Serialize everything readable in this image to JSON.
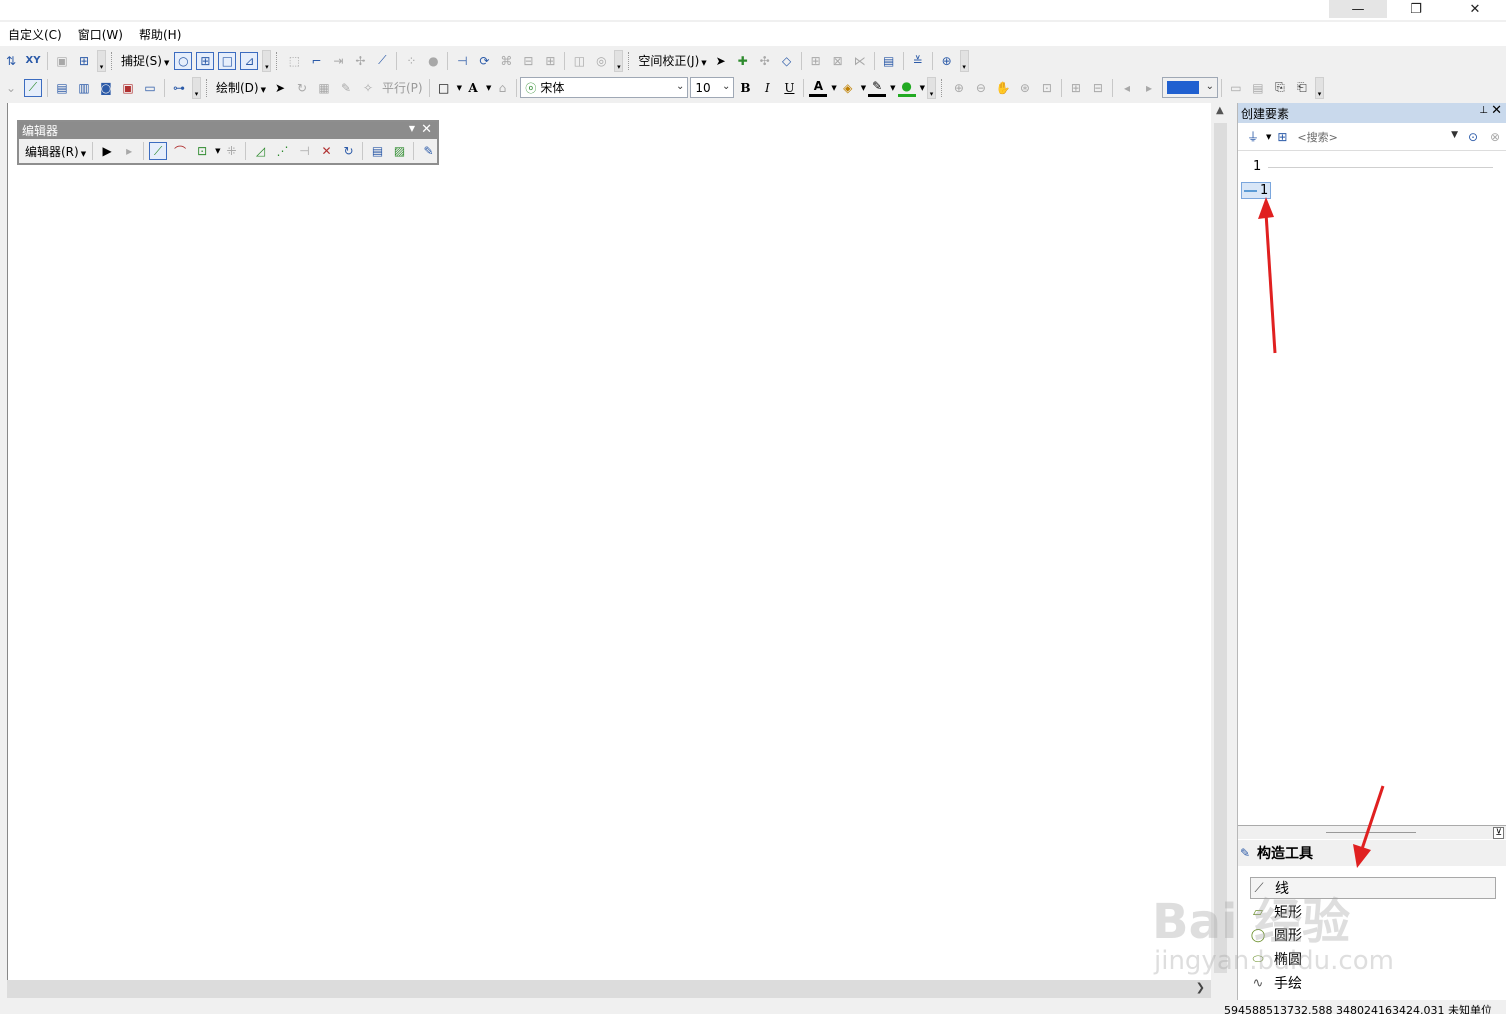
{
  "window": {
    "minimize_glyph": "—",
    "maximize_glyph": "❐",
    "close_glyph": "✕"
  },
  "menubar": {
    "items": [
      "自定义(C)",
      "窗口(W)",
      "帮助(H)"
    ]
  },
  "toolbar1": {
    "snapping_label": "捕捉(S)",
    "spatial_adjust_label": "空间校正(J)",
    "icons": [
      "add-data-icon",
      "xy-icon",
      "identify-icon",
      "magnifier-icon",
      "snap-point-icon",
      "snap-end-icon",
      "snap-vertex-icon",
      "snap-edge-icon",
      "arrow-tool-icon",
      "edit-vertex-icon",
      "reshape-icon",
      "rotate-icon",
      "attributes-icon",
      "sketch-properties-icon",
      "table-icon"
    ]
  },
  "toolbar2": {
    "draw_label": "绘制(D)",
    "parallel_label": "平行(P)",
    "font_name": "宋体",
    "font_size": "10",
    "bold_label": "B",
    "italic_label": "I",
    "underline_label": "U",
    "text_tool_label": "A"
  },
  "editor": {
    "window_title": "编辑器",
    "menu_label": "编辑器(R)"
  },
  "create_features": {
    "title": "创建要素",
    "search_placeholder": "<搜索>",
    "group_header": "1",
    "template_item": "1"
  },
  "construction_tools": {
    "title": "构造工具",
    "items": [
      "线",
      "矩形",
      "圆形",
      "椭圆",
      "手绘"
    ]
  },
  "statusbar": {
    "coordinates": "594588513732.588  348024163424.031 未知单位"
  },
  "watermark": {
    "text": "Bai 经验",
    "sub": "jingyan.baidu.com"
  },
  "colors": {
    "accent": "#2b5aa8",
    "panel_title": "#c9d9ec",
    "arrow": "#e02020",
    "selection": "#d8e6f7"
  }
}
